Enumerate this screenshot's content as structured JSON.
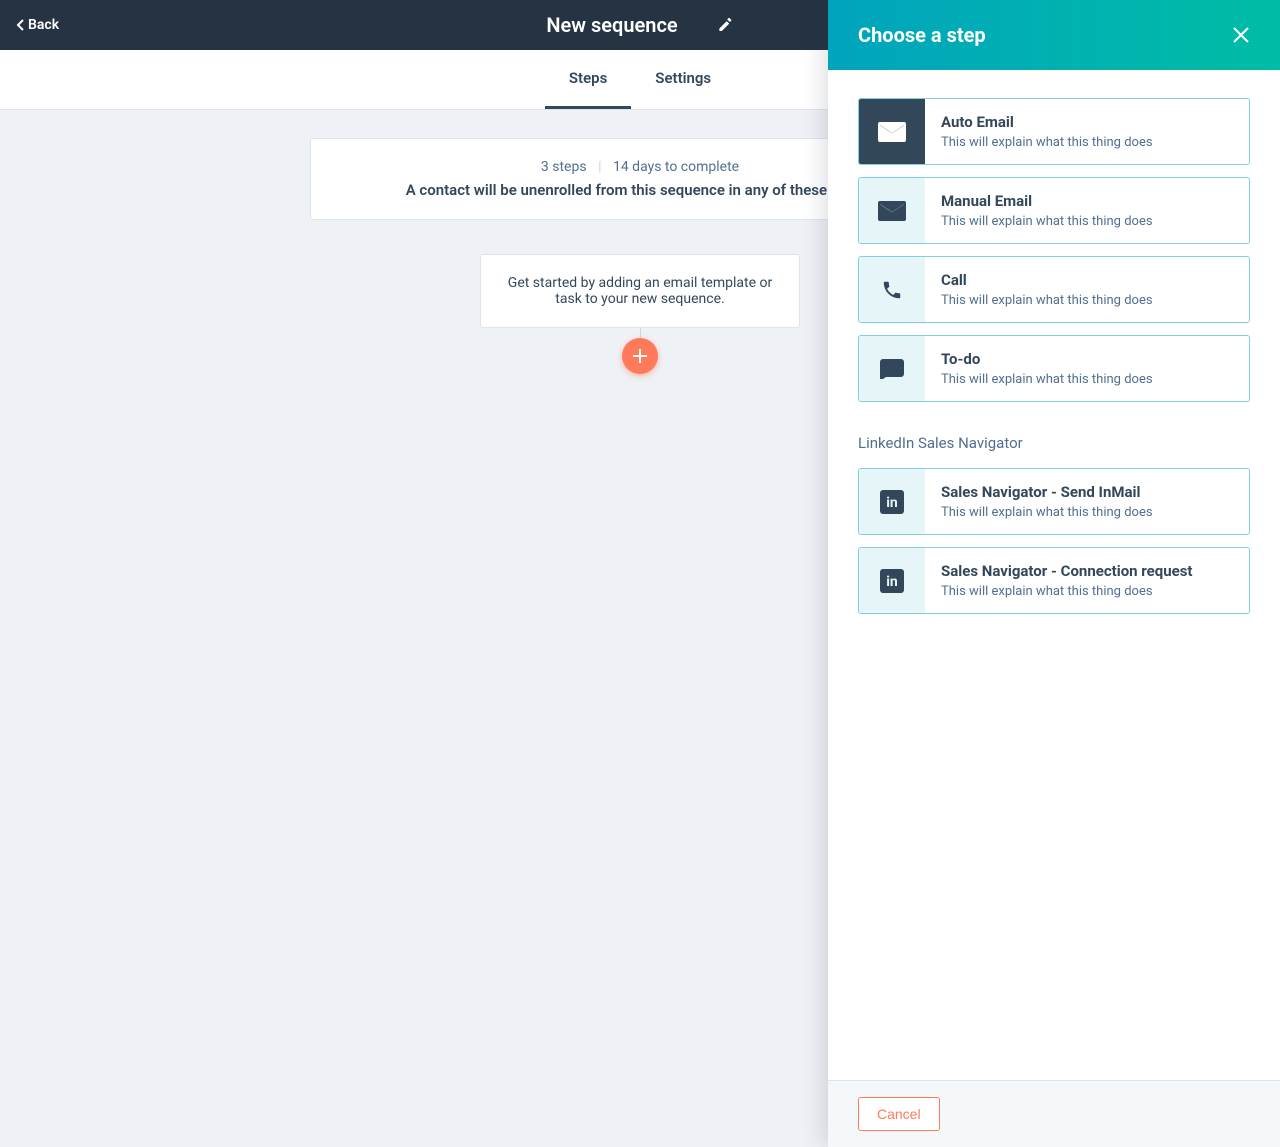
{
  "topbar": {
    "back_label": "Back",
    "page_title": "New sequence"
  },
  "tabs": {
    "steps": "Steps",
    "settings": "Settings"
  },
  "info": {
    "steps": "3 steps",
    "days": "14 days to complete",
    "sep": "|",
    "unenroll": "A contact will be unenrolled from this sequence in any of these cases:"
  },
  "start": {
    "text": "Get started by adding an email template or task to your new sequence."
  },
  "panel": {
    "title": "Choose a step",
    "section_label": "LinkedIn Sales Navigator",
    "cancel": "Cancel",
    "options": [
      {
        "title": "Auto Email",
        "desc": "This will explain what this thing does"
      },
      {
        "title": "Manual Email",
        "desc": "This will explain what this thing does"
      },
      {
        "title": "Call",
        "desc": "This will explain what this thing does"
      },
      {
        "title": "To-do",
        "desc": "This will explain what this thing does"
      }
    ],
    "linkedin": [
      {
        "title": "Sales Navigator - Send InMail",
        "desc": "This will explain what this thing does"
      },
      {
        "title": "Sales Navigator - Connection request",
        "desc": "This will explain what this thing does"
      }
    ]
  }
}
